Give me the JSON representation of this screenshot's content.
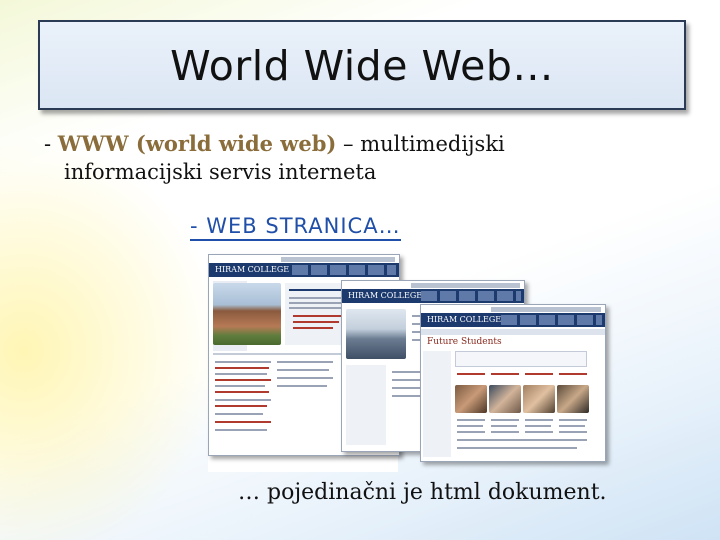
{
  "slide": {
    "title": "World Wide Web…",
    "bullet": {
      "dash": "- ",
      "term": "WWW (world wide web)",
      "rest": " – multimedijski",
      "line2": "informacijski servis interneta"
    },
    "subheading": "- WEB STRANICA…",
    "footer": "… pojedinačni je html dokument."
  },
  "screenshots": {
    "college_name": "HIRAM COLLEGE",
    "page3_heading": "Future Students"
  },
  "colors": {
    "title_border": "#2b3a55",
    "term": "#8a6d3b",
    "link": "#1f4fa8",
    "college_navy": "#1c3a6e"
  }
}
